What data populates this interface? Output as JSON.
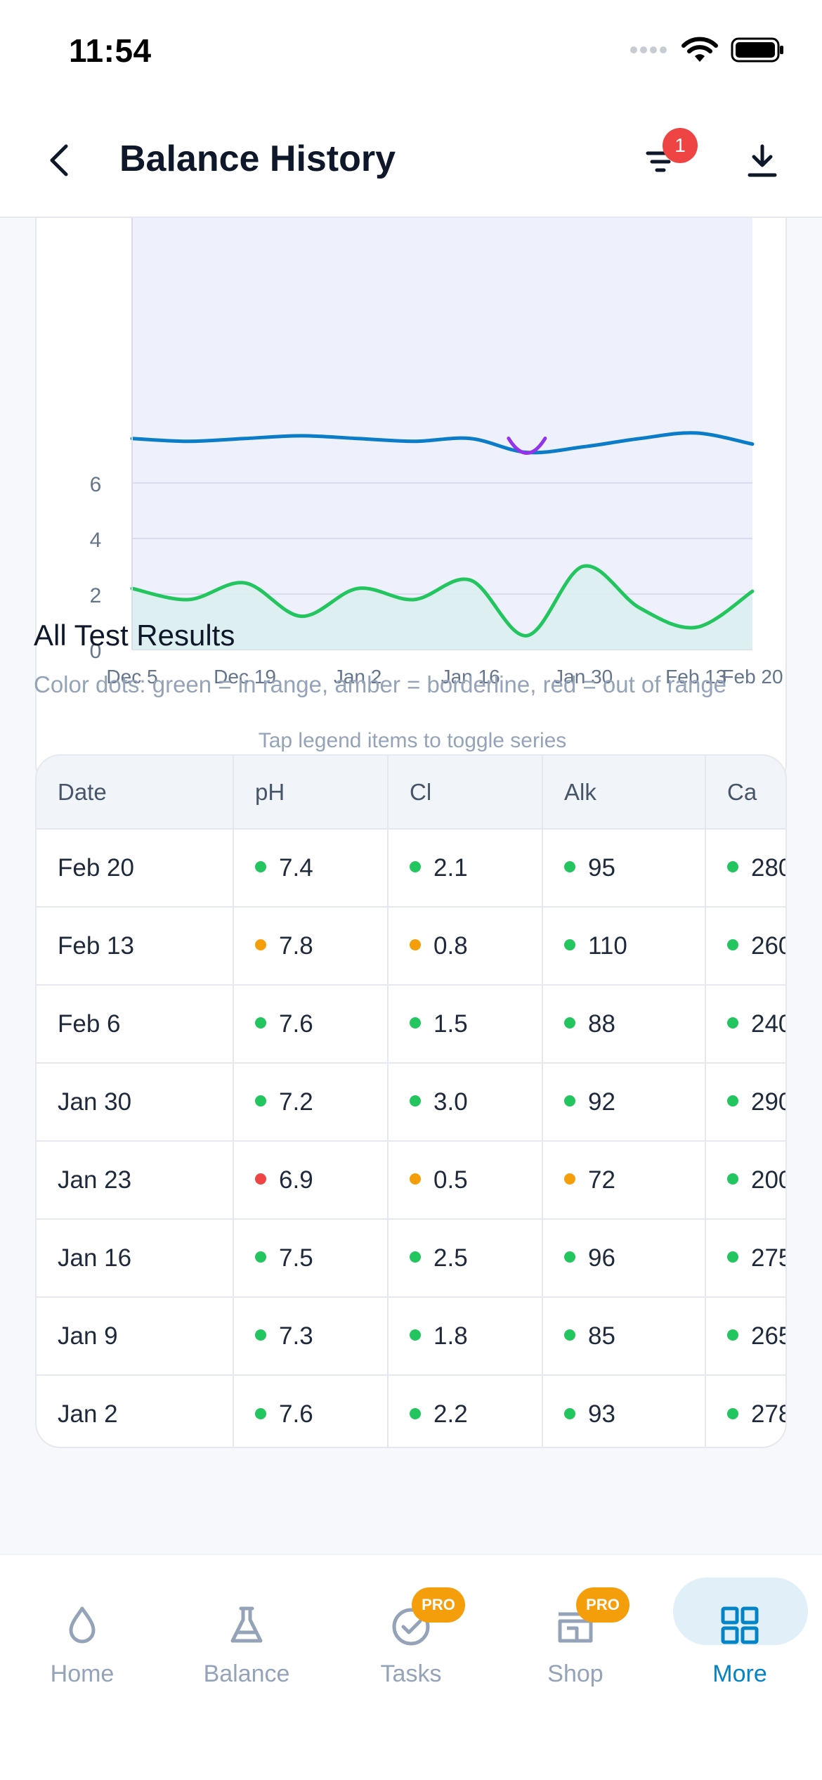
{
  "status_bar": {
    "time": "11:54"
  },
  "header": {
    "title": "Balance History",
    "filter_badge": "1"
  },
  "chart_data": {
    "type": "line",
    "ylim": [
      0,
      8
    ],
    "yticks": [
      "0",
      "2",
      "4",
      "6"
    ],
    "x_tick_labels": [
      "Dec 5",
      "Dec 19",
      "Jan 2",
      "Jan 16",
      "Jan 30",
      "Feb 13",
      "Feb 20"
    ],
    "x_dates": [
      "Dec 5",
      "Dec 12",
      "Dec 19",
      "Dec 26",
      "Jan 2",
      "Jan 9",
      "Jan 16",
      "Jan 23",
      "Jan 30",
      "Feb 6",
      "Feb 13",
      "Feb 20"
    ],
    "series": [
      {
        "values": [
          7.6,
          7.5,
          7.6,
          7.7,
          7.6,
          7.5,
          7.6,
          7.1,
          7.3,
          7.6,
          7.8,
          7.4
        ],
        "color": "#0b7dc8"
      },
      {
        "values": [
          2.2,
          1.8,
          2.4,
          1.2,
          2.2,
          1.8,
          2.5,
          0.5,
          3.0,
          1.5,
          0.8,
          2.1
        ],
        "color": "#22c55e"
      },
      {
        "values": [
          null,
          null,
          null,
          null,
          null,
          null,
          null,
          7.1,
          null,
          null,
          null,
          null
        ],
        "color": "#9333ea"
      }
    ],
    "hint": "Tap legend items to toggle series"
  },
  "results": {
    "title": "All Test Results",
    "subtitle": "Color dots: green = in range, amber = borderline, red = out of range",
    "columns": [
      "Date",
      "pH",
      "Cl",
      "Alk",
      "Ca"
    ],
    "rows": [
      {
        "date": "Feb 20",
        "cells": [
          {
            "v": "7.4",
            "s": "green"
          },
          {
            "v": "2.1",
            "s": "green"
          },
          {
            "v": "95",
            "s": "green"
          },
          {
            "v": "280",
            "s": "green"
          }
        ]
      },
      {
        "date": "Feb 13",
        "cells": [
          {
            "v": "7.8",
            "s": "amber"
          },
          {
            "v": "0.8",
            "s": "amber"
          },
          {
            "v": "110",
            "s": "green"
          },
          {
            "v": "260",
            "s": "green"
          }
        ]
      },
      {
        "date": "Feb 6",
        "cells": [
          {
            "v": "7.6",
            "s": "green"
          },
          {
            "v": "1.5",
            "s": "green"
          },
          {
            "v": "88",
            "s": "green"
          },
          {
            "v": "240",
            "s": "green"
          }
        ]
      },
      {
        "date": "Jan 30",
        "cells": [
          {
            "v": "7.2",
            "s": "green"
          },
          {
            "v": "3.0",
            "s": "green"
          },
          {
            "v": "92",
            "s": "green"
          },
          {
            "v": "290",
            "s": "green"
          }
        ]
      },
      {
        "date": "Jan 23",
        "cells": [
          {
            "v": "6.9",
            "s": "red"
          },
          {
            "v": "0.5",
            "s": "amber"
          },
          {
            "v": "72",
            "s": "amber"
          },
          {
            "v": "200",
            "s": "green"
          }
        ]
      },
      {
        "date": "Jan 16",
        "cells": [
          {
            "v": "7.5",
            "s": "green"
          },
          {
            "v": "2.5",
            "s": "green"
          },
          {
            "v": "96",
            "s": "green"
          },
          {
            "v": "275",
            "s": "green"
          }
        ]
      },
      {
        "date": "Jan 9",
        "cells": [
          {
            "v": "7.3",
            "s": "green"
          },
          {
            "v": "1.8",
            "s": "green"
          },
          {
            "v": "85",
            "s": "green"
          },
          {
            "v": "265",
            "s": "green"
          }
        ]
      },
      {
        "date": "Jan 2",
        "cells": [
          {
            "v": "7.6",
            "s": "green"
          },
          {
            "v": "2.2",
            "s": "green"
          },
          {
            "v": "93",
            "s": "green"
          },
          {
            "v": "278",
            "s": "green"
          }
        ]
      }
    ]
  },
  "status_colors": {
    "green": "#22c55e",
    "amber": "#f59e0b",
    "red": "#ef4444"
  },
  "tabs": [
    {
      "label": "Home",
      "icon": "water-drop-icon"
    },
    {
      "label": "Balance",
      "icon": "flask-icon"
    },
    {
      "label": "Tasks",
      "icon": "check-circle-icon",
      "badge": "PRO"
    },
    {
      "label": "Shop",
      "icon": "store-icon",
      "badge": "PRO"
    },
    {
      "label": "More",
      "icon": "grid-icon",
      "active": true
    }
  ],
  "accent": "#0284c7"
}
